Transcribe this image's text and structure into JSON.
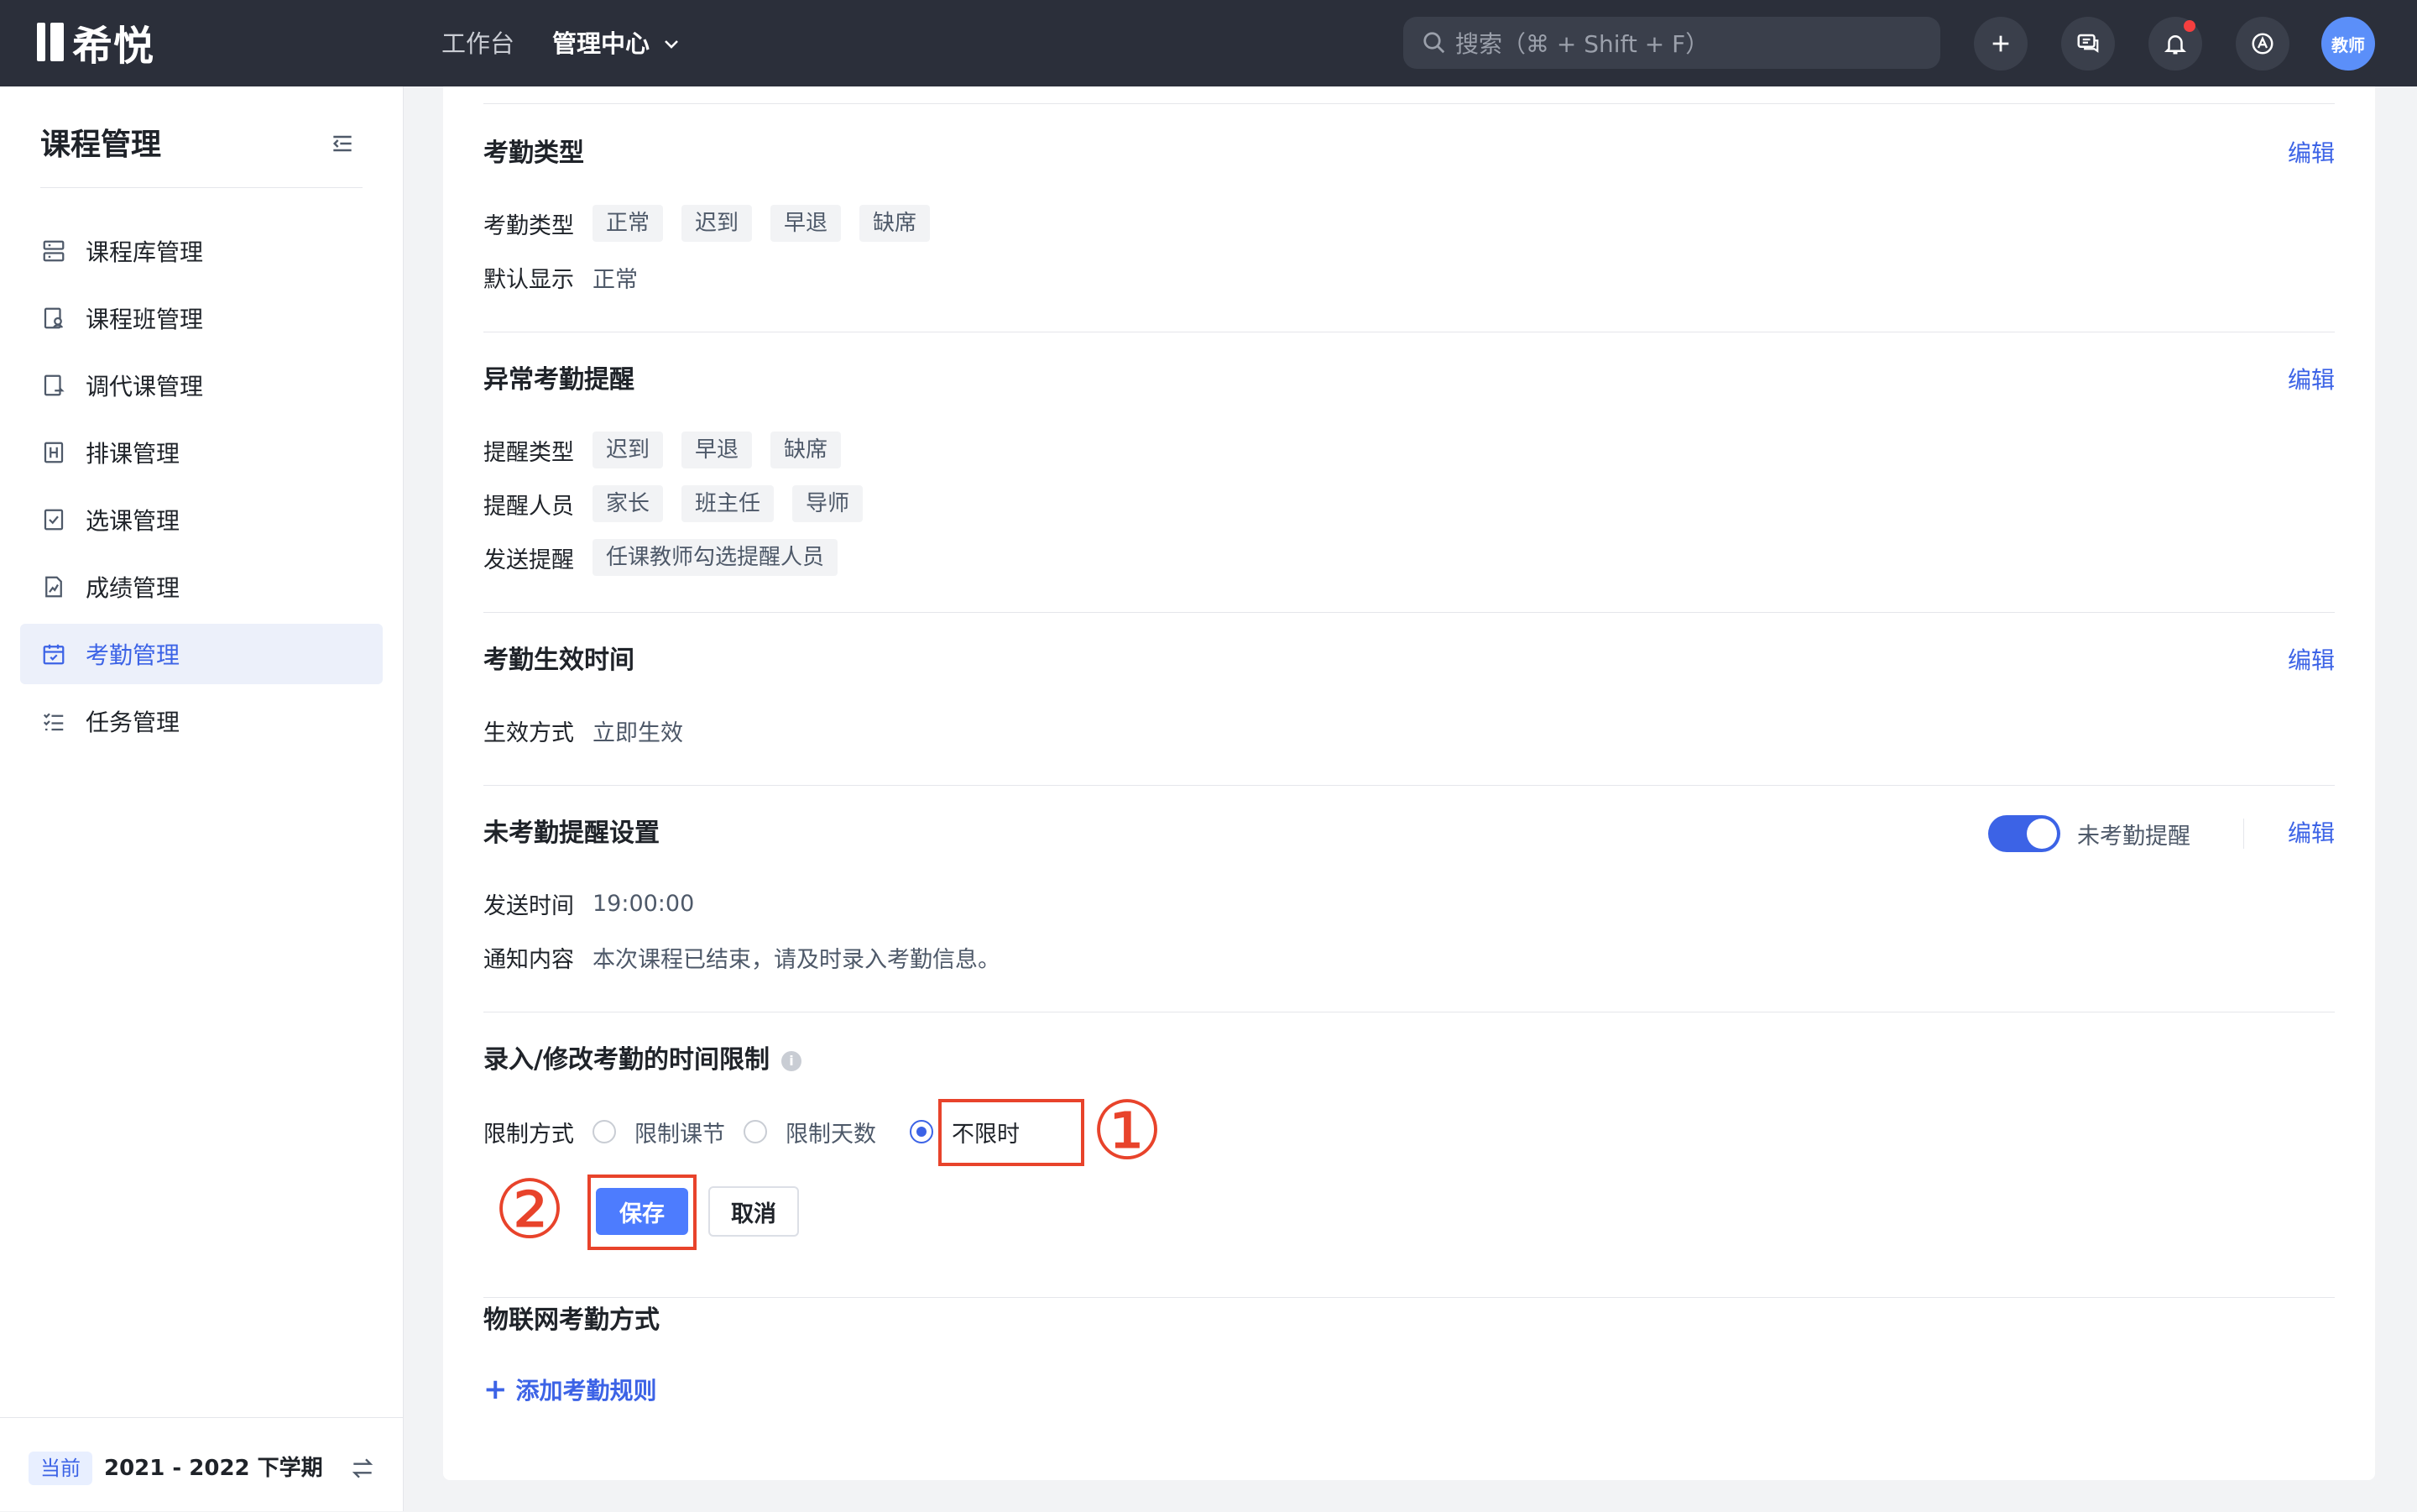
{
  "app": {
    "logo_text": "希悦"
  },
  "topnav": {
    "workbench": "工作台",
    "admin_center": "管理中心",
    "search_placeholder": "搜索（⌘ + Shift + F）",
    "avatar_text": "教师"
  },
  "sidebar": {
    "title": "课程管理",
    "items": [
      {
        "label": "课程库管理",
        "icon": "stack-icon"
      },
      {
        "label": "课程班管理",
        "icon": "class-icon"
      },
      {
        "label": "调代课管理",
        "icon": "swap-doc-icon"
      },
      {
        "label": "排课管理",
        "icon": "schedule-icon"
      },
      {
        "label": "选课管理",
        "icon": "check-box-icon"
      },
      {
        "label": "成绩管理",
        "icon": "chart-doc-icon"
      },
      {
        "label": "考勤管理",
        "icon": "calendar-check-icon",
        "active": true
      },
      {
        "label": "任务管理",
        "icon": "task-list-icon"
      }
    ],
    "term_chip": "当前",
    "term": "2021 - 2022 下学期"
  },
  "sections": {
    "attendance_type": {
      "title": "考勤类型",
      "edit": "编辑",
      "type_label": "考勤类型",
      "types": [
        "正常",
        "迟到",
        "早退",
        "缺席"
      ],
      "default_label": "默认显示",
      "default_value": "正常"
    },
    "abnormal_reminder": {
      "title": "异常考勤提醒",
      "edit": "编辑",
      "type_label": "提醒类型",
      "types": [
        "迟到",
        "早退",
        "缺席"
      ],
      "people_label": "提醒人员",
      "people": [
        "家长",
        "班主任",
        "导师"
      ],
      "send_label": "发送提醒",
      "send_value": "任课教师勾选提醒人员"
    },
    "effective_time": {
      "title": "考勤生效时间",
      "edit": "编辑",
      "mode_label": "生效方式",
      "mode_value": "立即生效"
    },
    "unattended_reminder": {
      "title": "未考勤提醒设置",
      "edit": "编辑",
      "toggle_label": "未考勤提醒",
      "toggle_on": true,
      "time_label": "发送时间",
      "time_value": "19:00:00",
      "content_label": "通知内容",
      "content_value": "本次课程已结束，请及时录入考勤信息。"
    },
    "time_limit": {
      "title": "录入/修改考勤的时间限制",
      "info_icon": "i",
      "mode_label": "限制方式",
      "options": [
        "限制课节",
        "限制天数",
        "不限时"
      ],
      "selected": "不限时",
      "save": "保存",
      "cancel": "取消",
      "annotation_1": "①",
      "annotation_2": "②"
    },
    "iot": {
      "title": "物联网考勤方式",
      "add_rule": "添加考勤规则"
    }
  },
  "colors": {
    "accent": "#3c63e6",
    "topbar": "#2b2f3a",
    "annotation": "#e8432b"
  }
}
